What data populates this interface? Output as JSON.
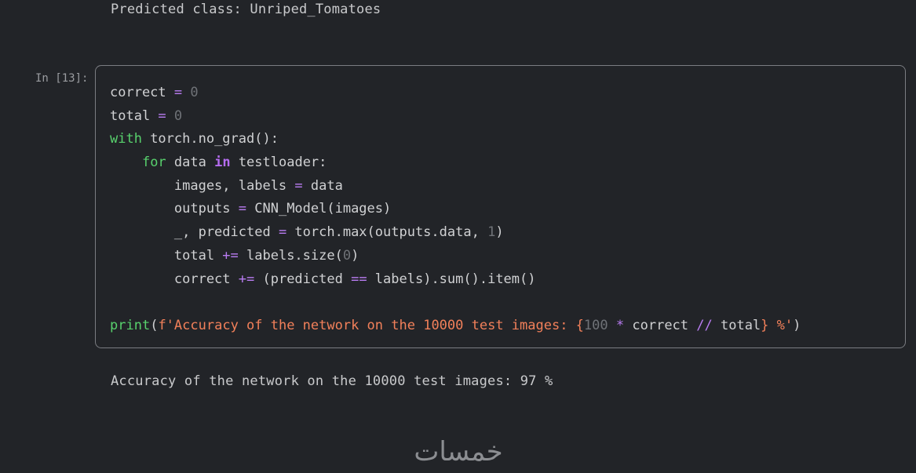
{
  "outputs": {
    "previous": "Predicted class: Unriped_Tomatoes",
    "accuracy": "Accuracy of the network on the 10000 test images: 97 %"
  },
  "cell": {
    "prompt": "In [13]:",
    "code_lines": [
      "correct = 0",
      "total = 0",
      "with torch.no_grad():",
      "    for data in testloader:",
      "        images, labels = data",
      "        outputs = CNN_Model(images)",
      "        _, predicted = torch.max(outputs.data, 1)",
      "        total += labels.size(0)",
      "        correct += (predicted == labels).sum().item()",
      "",
      "print(f'Accuracy of the network on the 10000 test images: {100 * correct // total} %')"
    ]
  },
  "watermark": {
    "text": "خمسات",
    "color": "#8c8e92"
  },
  "colors": {
    "background": "#222428",
    "keyword": "#58d16d",
    "operator": "#b97cf2",
    "string": "#f2805a",
    "number": "#6f7277"
  }
}
